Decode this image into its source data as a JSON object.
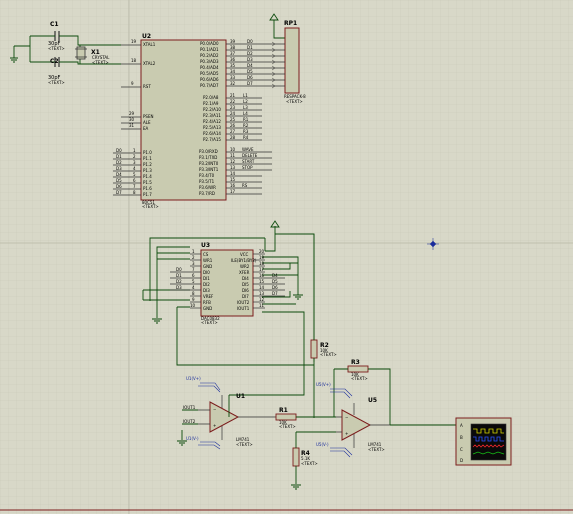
{
  "colors": {
    "background": "#d8d8c8",
    "grid": "#c4c4b2",
    "wire": "#0b4a0b",
    "component_fill": "#c9cbb0",
    "component_outline": "#7b1c1c",
    "label_blue": "#1a2d9c"
  },
  "text_placeholder": "<TEXT>",
  "c1": {
    "ref": "C1",
    "value": "30pF"
  },
  "c2": {
    "ref": "C2",
    "value": "30pF"
  },
  "x1": {
    "ref": "X1",
    "value": "CRYSTAL"
  },
  "u2": {
    "ref": "U2",
    "part": "80C51",
    "left_pins": [
      {
        "num": "19",
        "name": "XTAL1"
      },
      {
        "num": "18",
        "name": "XTAL2"
      },
      {
        "num": "9",
        "name": "RST"
      },
      {
        "num": "29",
        "name": "PSEN"
      },
      {
        "num": "30",
        "name": "ALE"
      },
      {
        "num": "31",
        "name": "EA"
      }
    ],
    "p1_pins": [
      {
        "num": "1",
        "name": "P1.0"
      },
      {
        "num": "2",
        "name": "P1.1"
      },
      {
        "num": "3",
        "name": "P1.2"
      },
      {
        "num": "4",
        "name": "P1.3"
      },
      {
        "num": "5",
        "name": "P1.4"
      },
      {
        "num": "6",
        "name": "P1.5"
      },
      {
        "num": "7",
        "name": "P1.6"
      },
      {
        "num": "8",
        "name": "P1.7"
      }
    ],
    "p1_nets": [
      "D0",
      "D1",
      "D2",
      "D3",
      "D4",
      "D5",
      "D6",
      "D7"
    ],
    "p0_pins": [
      {
        "num": "39",
        "name": "P0.0/AD0",
        "net": "D0"
      },
      {
        "num": "38",
        "name": "P0.1/AD1",
        "net": "D1"
      },
      {
        "num": "37",
        "name": "P0.2/AD2",
        "net": "D2"
      },
      {
        "num": "36",
        "name": "P0.3/AD3",
        "net": "D3"
      },
      {
        "num": "35",
        "name": "P0.4/AD4",
        "net": "D4"
      },
      {
        "num": "34",
        "name": "P0.5/AD5",
        "net": "D5"
      },
      {
        "num": "33",
        "name": "P0.6/AD6",
        "net": "D6"
      },
      {
        "num": "32",
        "name": "P0.7/AD7",
        "net": "D7"
      }
    ],
    "p2_pins": [
      {
        "num": "21",
        "name": "P2.0/A8",
        "net": "L1"
      },
      {
        "num": "22",
        "name": "P2.1/A9",
        "net": "L2"
      },
      {
        "num": "23",
        "name": "P2.2/A10",
        "net": "L3"
      },
      {
        "num": "24",
        "name": "P2.3/A11",
        "net": "L4"
      },
      {
        "num": "25",
        "name": "P2.4/A12",
        "net": "R1"
      },
      {
        "num": "26",
        "name": "P2.5/A13",
        "net": "R2"
      },
      {
        "num": "27",
        "name": "P2.6/A14",
        "net": "R3"
      },
      {
        "num": "28",
        "name": "P2.7/A15",
        "net": "R4"
      }
    ],
    "p3_pins": [
      {
        "num": "10",
        "name": "P3.0/RXD",
        "net": "WAVE"
      },
      {
        "num": "11",
        "name": "P3.1/TXD",
        "net": "DELETE"
      },
      {
        "num": "12",
        "name": "P3.2/INT0",
        "net": "START"
      },
      {
        "num": "13",
        "name": "P3.3/INT1",
        "net": "STOP"
      },
      {
        "num": "14",
        "name": "P3.4/T0",
        "net": ""
      },
      {
        "num": "15",
        "name": "P3.5/T1",
        "net": ""
      },
      {
        "num": "16",
        "name": "P3.6/WR",
        "net": "RS"
      },
      {
        "num": "17",
        "name": "P3.7/RD",
        "net": ""
      }
    ]
  },
  "rp1": {
    "ref": "RP1",
    "part": "RESPACK-8"
  },
  "u3": {
    "ref": "U3",
    "part": "DAC0832",
    "left_pins": [
      {
        "num": "1",
        "name": "CS"
      },
      {
        "num": "2",
        "name": "WR1"
      },
      {
        "num": "3",
        "name": "GND"
      },
      {
        "num": "7",
        "name": "DI0"
      },
      {
        "num": "6",
        "name": "DI1"
      },
      {
        "num": "5",
        "name": "DI2"
      },
      {
        "num": "4",
        "name": "DI3"
      },
      {
        "num": "8",
        "name": "VREF"
      },
      {
        "num": "9",
        "name": "RFB"
      },
      {
        "num": "10",
        "name": "GND"
      }
    ],
    "left_nets": [
      "",
      "",
      "",
      "D0",
      "D1",
      "D2",
      "D3",
      "",
      "",
      ""
    ],
    "right_pins": [
      {
        "num": "20",
        "name": "VCC"
      },
      {
        "num": "19",
        "name": "ILE(BY1/BY2)"
      },
      {
        "num": "18",
        "name": "WR2"
      },
      {
        "num": "17",
        "name": "XFER"
      },
      {
        "num": "16",
        "name": "DI4"
      },
      {
        "num": "15",
        "name": "DI5"
      },
      {
        "num": "14",
        "name": "DI6"
      },
      {
        "num": "13",
        "name": "DI7"
      },
      {
        "num": "12",
        "name": "IOUT2"
      },
      {
        "num": "11",
        "name": "IOUT1"
      }
    ],
    "right_nets": [
      "",
      "",
      "",
      "",
      "D4",
      "D5",
      "D6",
      "D7",
      "",
      ""
    ]
  },
  "u1": {
    "ref": "U1",
    "part": "LM741",
    "pins": [
      "3",
      "2",
      "6",
      "7",
      "4"
    ],
    "net_vp": "IOUT1",
    "net_vn": "IOUT2",
    "supply_top": "U1(V+)",
    "supply_bot": "U1(V-)"
  },
  "u5": {
    "ref": "U5",
    "part": "LM741",
    "supply_top": "U5(V+)",
    "supply_bot": "U5(V-)"
  },
  "r1": {
    "ref": "R1",
    "value": "10K"
  },
  "r2": {
    "ref": "R2",
    "value": "10K"
  },
  "r3": {
    "ref": "R3",
    "value": "10K"
  },
  "r4": {
    "ref": "R4",
    "value": "5.1K"
  },
  "scope": {
    "channels": [
      "A",
      "B",
      "C",
      "D"
    ],
    "trace_colors": [
      "#d8d800",
      "#2a52ff",
      "#e8262a",
      "#18c018"
    ]
  }
}
